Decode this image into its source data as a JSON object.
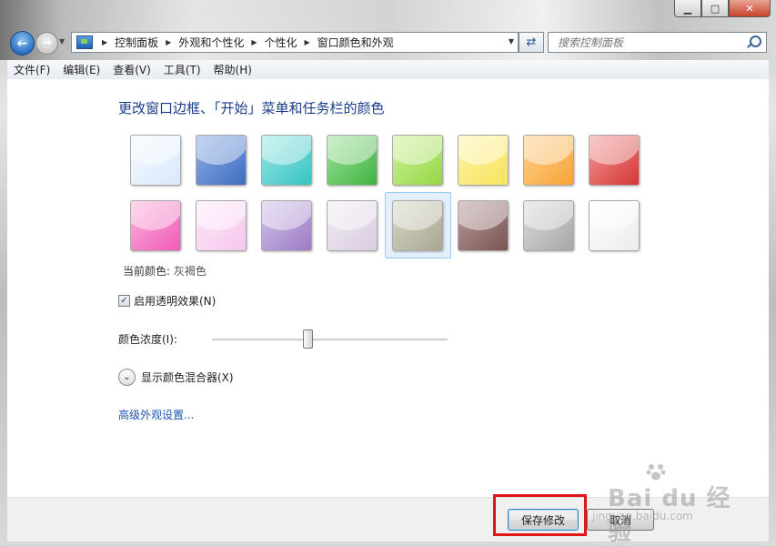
{
  "window": {
    "caption_buttons": {
      "minimize": "▁",
      "maximize": "□",
      "close": "✕"
    }
  },
  "nav": {
    "breadcrumbs": [
      "控制面板",
      "外观和个性化",
      "个性化",
      "窗口颜色和外观"
    ],
    "search_placeholder": "搜索控制面板",
    "icons": {
      "back": "back-arrow-icon",
      "forward": "forward-arrow-icon",
      "refresh": "refresh-icon",
      "search": "search-icon"
    }
  },
  "menu": {
    "items": [
      "文件(F)",
      "编辑(E)",
      "查看(V)",
      "工具(T)",
      "帮助(H)"
    ]
  },
  "main": {
    "heading": "更改窗口边框、「开始」菜单和任务栏的颜色",
    "swatches": [
      {
        "name": "sky",
        "color": "#d9e9fb",
        "color2": "#f4f9ff"
      },
      {
        "name": "twilight",
        "color": "#3e6cc0",
        "color2": "#8fb0e6"
      },
      {
        "name": "sea",
        "color": "#37c4c4",
        "color2": "#9be7e4"
      },
      {
        "name": "leaf",
        "color": "#3fb43f",
        "color2": "#9fe29a"
      },
      {
        "name": "lime",
        "color": "#97d645",
        "color2": "#cdf29a"
      },
      {
        "name": "lemon",
        "color": "#f6e35c",
        "color2": "#fff4a8"
      },
      {
        "name": "pumpkin",
        "color": "#f7a336",
        "color2": "#fdd28f"
      },
      {
        "name": "ruby",
        "color": "#d53636",
        "color2": "#f29a96"
      },
      {
        "name": "fuchsia",
        "color": "#f05ab7",
        "color2": "#fbb4dd"
      },
      {
        "name": "blush",
        "color": "#f5c6ec",
        "color2": "#fde9f9"
      },
      {
        "name": "violet",
        "color": "#9b7bc4",
        "color2": "#d3c3ea"
      },
      {
        "name": "lavender",
        "color": "#d9cde0",
        "color2": "#f1ebf4"
      },
      {
        "name": "taupe",
        "color": "#a9a692",
        "color2": "#d9d7c9"
      },
      {
        "name": "chocolate",
        "color": "#7a5454",
        "color2": "#b79c9a"
      },
      {
        "name": "slate",
        "color": "#a6a6a6",
        "color2": "#dcdcdc"
      },
      {
        "name": "frost",
        "color": "#ececec",
        "color2": "#ffffff"
      }
    ],
    "selected_index": 12,
    "current_color_label": "当前颜色:",
    "current_color_value": "灰褐色",
    "transparency_label": "启用透明效果(N)",
    "transparency_checked": true,
    "intensity_label": "颜色浓度(I):",
    "intensity_fraction": 0.4,
    "mixer_label": "显示颜色混合器(X)",
    "advanced_link": "高级外观设置..."
  },
  "footer": {
    "save_label": "保存修改",
    "cancel_label": "取消"
  },
  "watermark": {
    "text": "Bai du 经验",
    "sub": "jingyan.baidu.com"
  }
}
